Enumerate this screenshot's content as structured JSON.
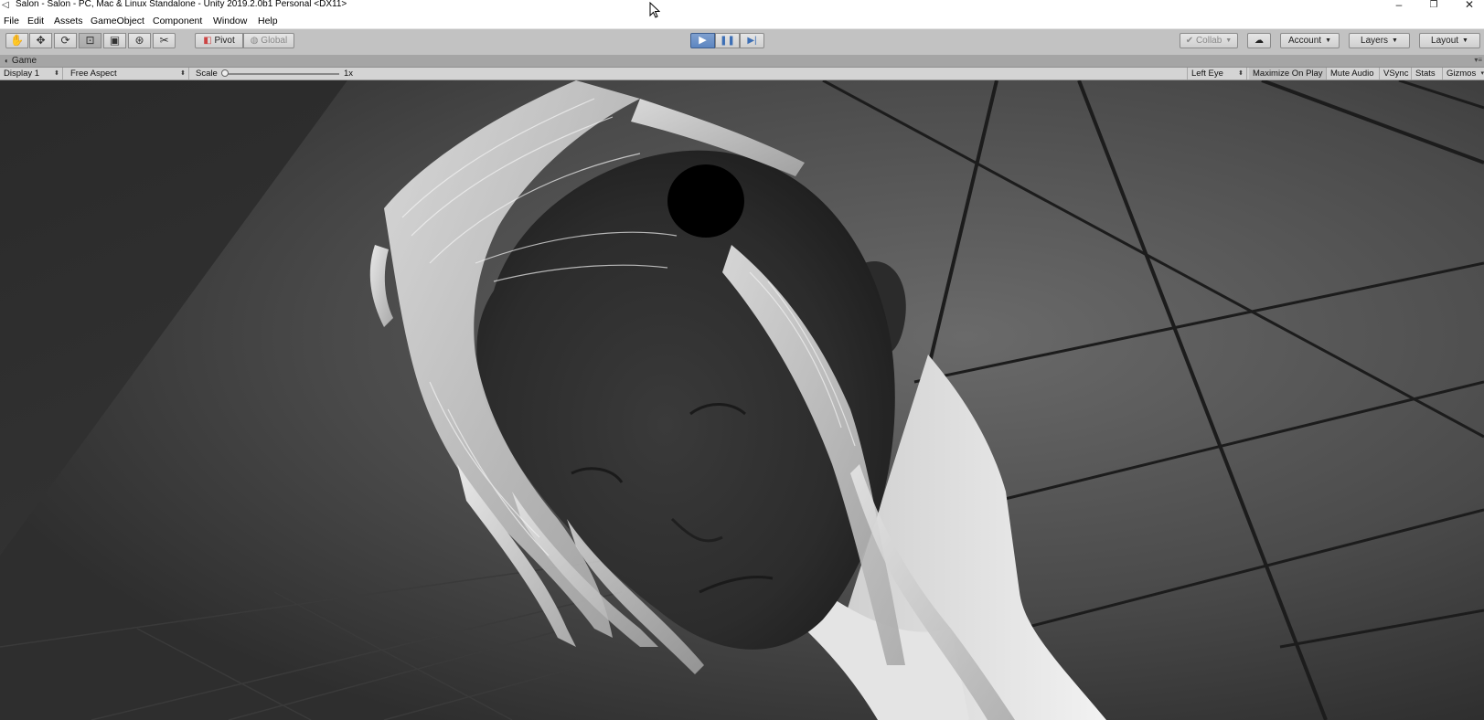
{
  "window": {
    "title": "Salon - Salon - PC, Mac & Linux Standalone - Unity 2019.2.0b1 Personal <DX11>",
    "controls": [
      "minimize-icon",
      "restore-icon",
      "close-icon"
    ]
  },
  "menu": [
    "File",
    "Edit",
    "Assets",
    "GameObject",
    "Component",
    "Window",
    "Help"
  ],
  "toolbar": {
    "tools": [
      "hand-icon",
      "move-icon",
      "rotate-icon",
      "scale-icon",
      "rect-icon",
      "transform-icon",
      "custom-tool-icon"
    ],
    "pivot_label": "Pivot",
    "global_label": "Global",
    "play_icon": "play-icon",
    "pause_icon": "pause-icon",
    "step_icon": "step-icon",
    "collab_label": "Collab",
    "cloud_icon": "cloud-icon",
    "account_label": "Account",
    "layers_label": "Layers",
    "layout_label": "Layout",
    "play_active": true,
    "accent_color": "#5d86c1"
  },
  "tab": {
    "label": "Game",
    "icon": "game-view-icon"
  },
  "gamebar": {
    "display": "Display 1",
    "aspect": "Free Aspect",
    "scale_label": "Scale",
    "scale_value": "1x",
    "eye": "Left Eye",
    "maximize": "Maximize On Play",
    "mute": "Mute Audio",
    "vsync": "VSync",
    "stats": "Stats",
    "gizmos": "Gizmos"
  }
}
